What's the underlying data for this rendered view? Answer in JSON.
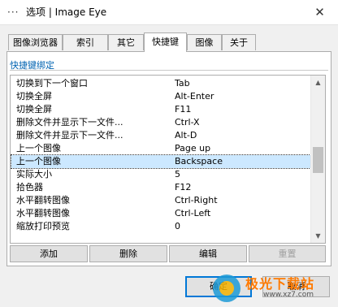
{
  "window": {
    "icon_glyph": "···",
    "title": "选项 | Image Eye",
    "close_glyph": "✕"
  },
  "tabs": [
    {
      "label": "图像浏览器"
    },
    {
      "label": "索引"
    },
    {
      "label": "其它"
    },
    {
      "label": "快捷键"
    },
    {
      "label": "图像"
    },
    {
      "label": "关于"
    }
  ],
  "active_tab": "快捷键",
  "group": {
    "title": "快捷键绑定"
  },
  "shortcuts": [
    {
      "action": "切换到下一个窗口",
      "key": "Tab"
    },
    {
      "action": "切换全屏",
      "key": "Alt-Enter"
    },
    {
      "action": "切换全屏",
      "key": "F11"
    },
    {
      "action": "删除文件并显示下一文件...",
      "key": "Ctrl-X"
    },
    {
      "action": "删除文件并显示下一文件...",
      "key": "Alt-D"
    },
    {
      "action": "上一个图像",
      "key": "Page up"
    },
    {
      "action": "上一个图像",
      "key": "Backspace"
    },
    {
      "action": "实际大小",
      "key": "5"
    },
    {
      "action": "拾色器",
      "key": "F12"
    },
    {
      "action": "水平翻转图像",
      "key": "Ctrl-Right"
    },
    {
      "action": "水平翻转图像",
      "key": "Ctrl-Left"
    },
    {
      "action": "缩放打印预览",
      "key": "0"
    }
  ],
  "selected_row": 6,
  "scrollbar": {
    "up_glyph": "▲",
    "down_glyph": "▼"
  },
  "list_buttons": {
    "add": "添加",
    "delete": "删除",
    "edit": "编辑",
    "reset": "重置"
  },
  "dialog_buttons": {
    "ok": "确定",
    "cancel": "取消"
  },
  "watermark": {
    "name": "极光下载站",
    "url": "www.xz7.com"
  },
  "colors": {
    "accent": "#0078d7",
    "group_title": "#0063b1",
    "selection": "#cce8ff"
  }
}
